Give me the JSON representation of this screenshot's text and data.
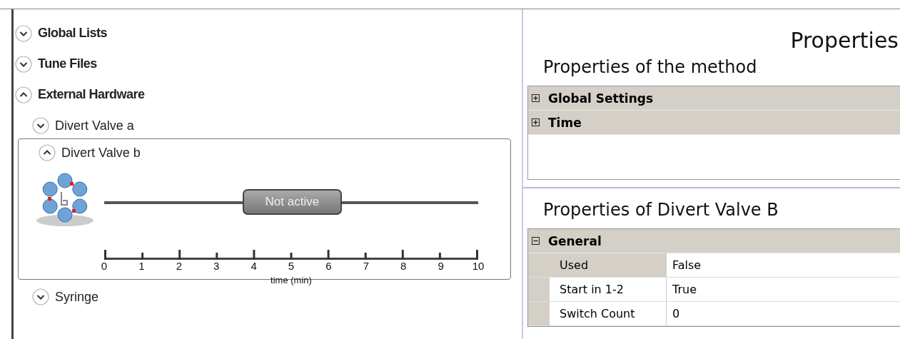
{
  "tree": [
    {
      "label": "Global Lists",
      "expanded": false
    },
    {
      "label": "Tune Files",
      "expanded": false
    },
    {
      "label": "External Hardware",
      "expanded": true,
      "children": [
        {
          "label": "Divert Valve a",
          "expanded": false
        },
        {
          "label": "Divert Valve b",
          "expanded": true,
          "timeline": {
            "segment": "Not active",
            "ticks": [
              "0",
              "1",
              "2",
              "3",
              "4",
              "5",
              "6",
              "7",
              "8",
              "9",
              "10"
            ],
            "axis_label": "time (min)"
          }
        },
        {
          "label": "Syringe",
          "expanded": false
        }
      ]
    }
  ],
  "properties": {
    "title": "Properties",
    "sections": [
      {
        "title": "Properties of the method",
        "categories": [
          {
            "label": "Global Settings",
            "expanded": false
          },
          {
            "label": "Time",
            "expanded": false
          }
        ]
      },
      {
        "title": "Properties of Divert Valve B",
        "categories": [
          {
            "label": "General",
            "expanded": true,
            "rows": [
              {
                "name": "Used",
                "value": "False",
                "selected": true
              },
              {
                "name": "Start in 1-2",
                "value": "True",
                "selected": false
              },
              {
                "name": "Switch Count",
                "value": "0",
                "selected": false
              }
            ]
          }
        ]
      }
    ]
  }
}
